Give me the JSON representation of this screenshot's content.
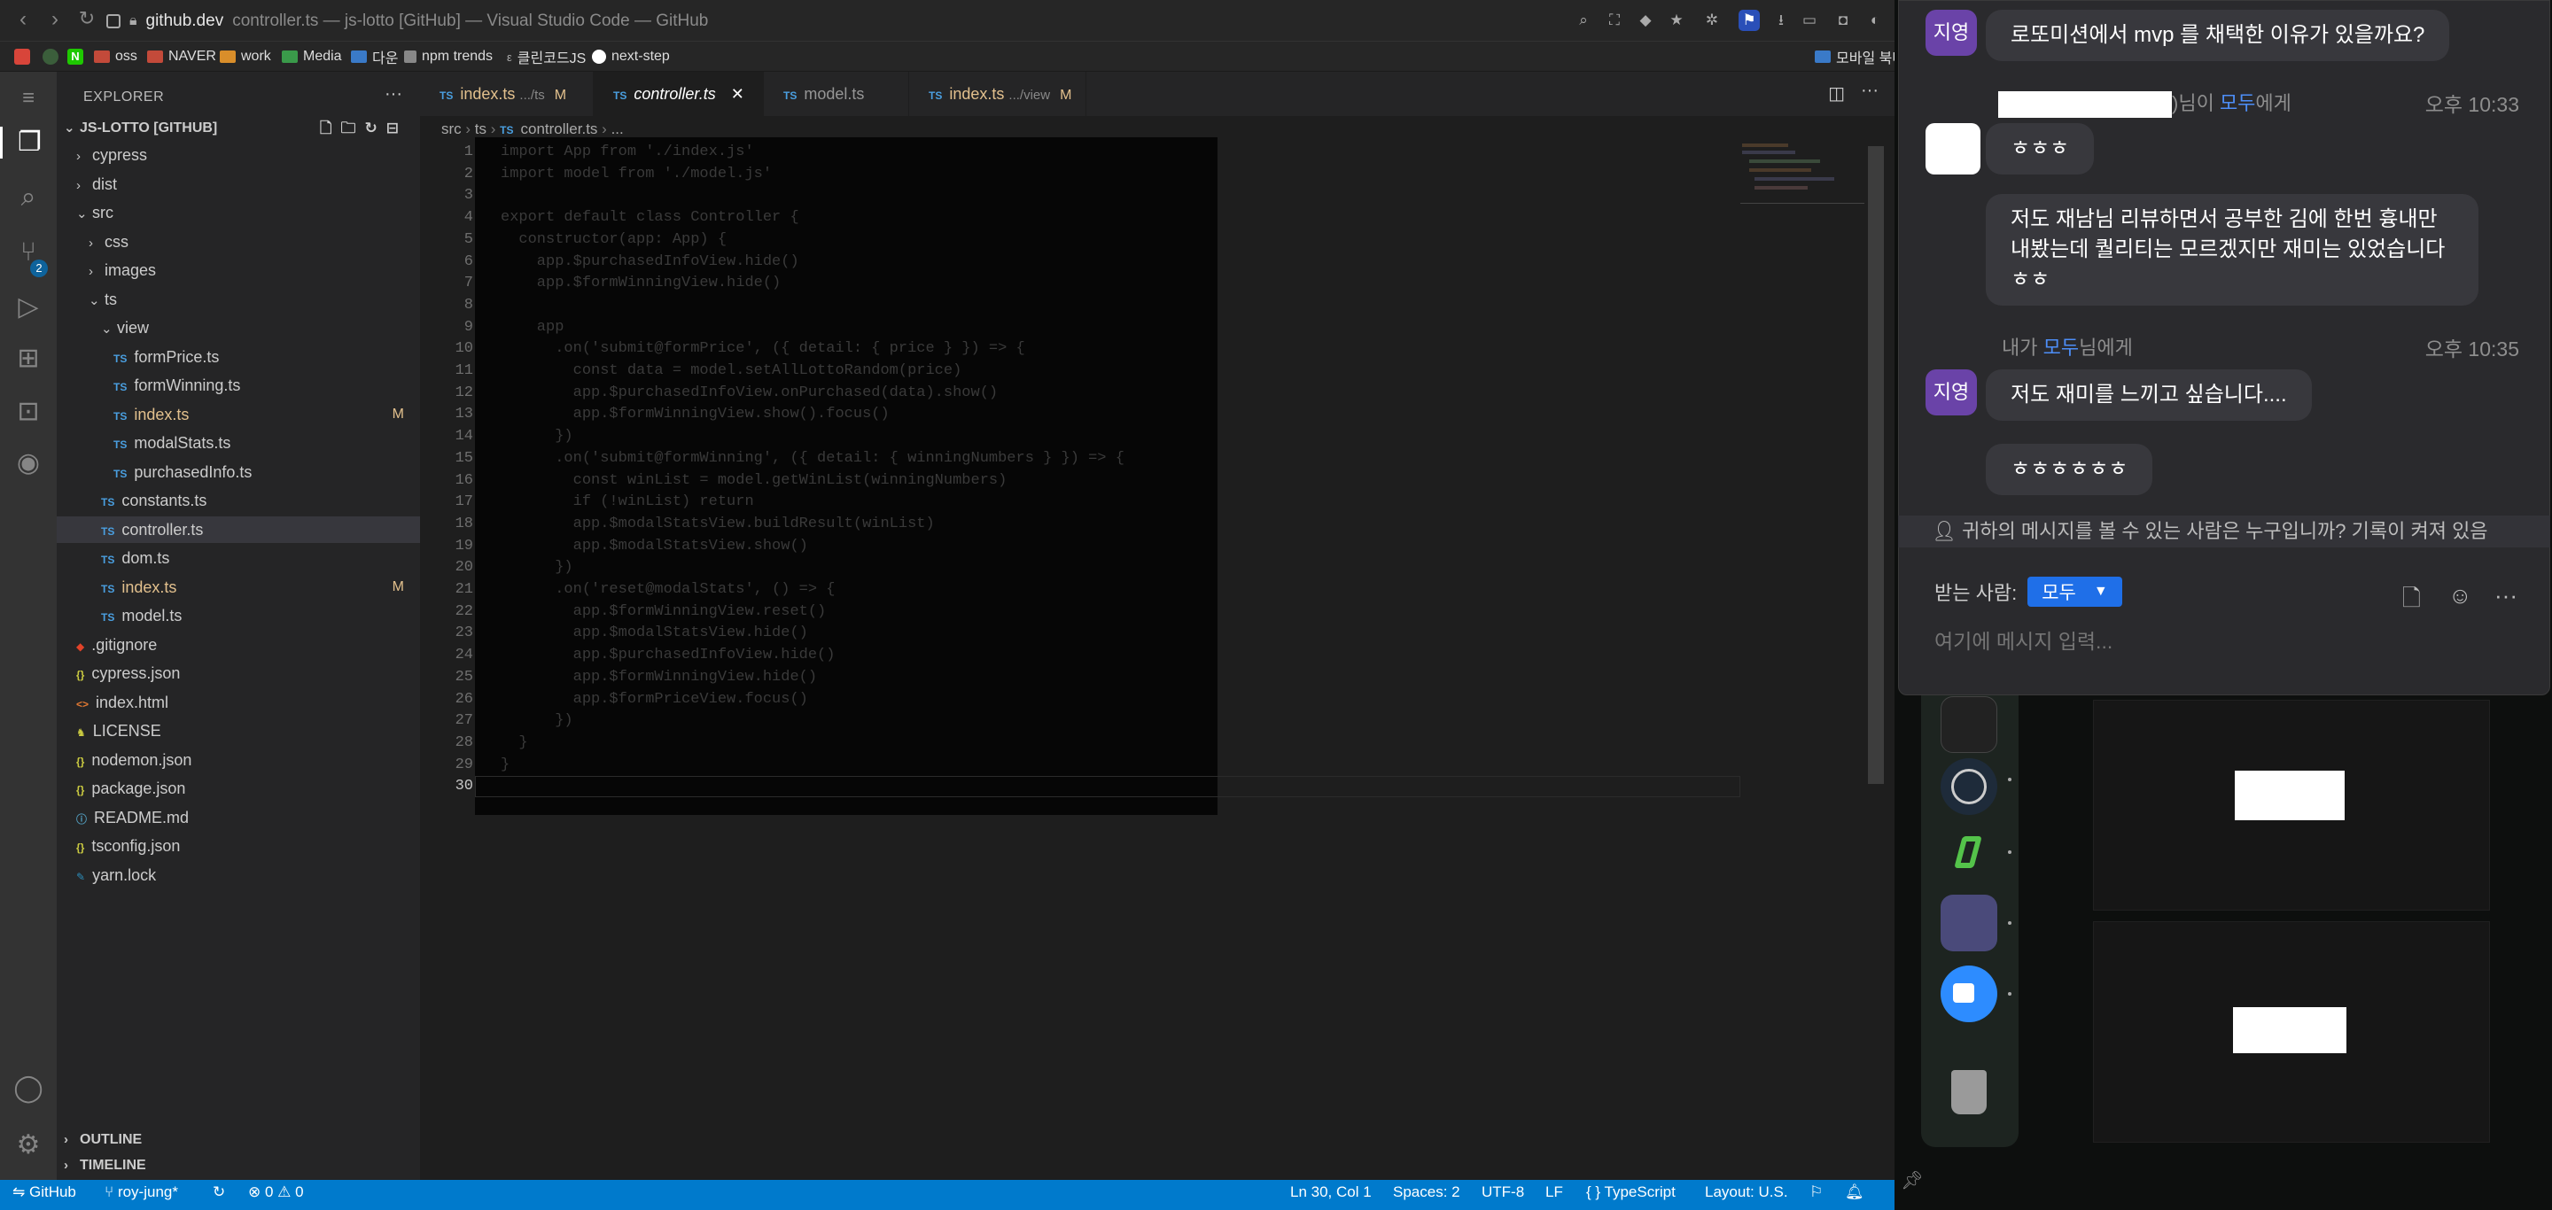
{
  "browser": {
    "domain": "github.dev",
    "page_title": "controller.ts — js-lotto [GitHub] — Visual Studio Code — GitHub",
    "bookmarks": [
      "oss",
      "NAVER",
      "work",
      "Media",
      "다운",
      "npm trends",
      "클린코드JS",
      "next-step"
    ],
    "bookmarks_right": "모바일 북마"
  },
  "explorer": {
    "title": "EXPLORER",
    "root": "JS-LOTTO [GITHUB]",
    "tree": [
      {
        "label": "cypress",
        "kind": "folder",
        "depth": 1,
        "open": false
      },
      {
        "label": "dist",
        "kind": "folder",
        "depth": 1,
        "open": false
      },
      {
        "label": "src",
        "kind": "folder",
        "depth": 1,
        "open": true
      },
      {
        "label": "css",
        "kind": "folder",
        "depth": 2,
        "open": false
      },
      {
        "label": "images",
        "kind": "folder",
        "depth": 2,
        "open": false
      },
      {
        "label": "ts",
        "kind": "folder",
        "depth": 2,
        "open": true
      },
      {
        "label": "view",
        "kind": "folder",
        "depth": 3,
        "open": true
      },
      {
        "label": "formPrice.ts",
        "kind": "ts",
        "depth": 4
      },
      {
        "label": "formWinning.ts",
        "kind": "ts",
        "depth": 4
      },
      {
        "label": "index.ts",
        "kind": "ts",
        "depth": 4,
        "modified": "M"
      },
      {
        "label": "modalStats.ts",
        "kind": "ts",
        "depth": 4
      },
      {
        "label": "purchasedInfo.ts",
        "kind": "ts",
        "depth": 4
      },
      {
        "label": "constants.ts",
        "kind": "ts",
        "depth": 3
      },
      {
        "label": "controller.ts",
        "kind": "ts",
        "depth": 3,
        "selected": true
      },
      {
        "label": "dom.ts",
        "kind": "ts",
        "depth": 3
      },
      {
        "label": "index.ts",
        "kind": "ts",
        "depth": 3,
        "modified": "M"
      },
      {
        "label": "model.ts",
        "kind": "ts",
        "depth": 3
      },
      {
        "label": ".gitignore",
        "kind": "git",
        "depth": 1
      },
      {
        "label": "cypress.json",
        "kind": "json",
        "depth": 1
      },
      {
        "label": "index.html",
        "kind": "html",
        "depth": 1
      },
      {
        "label": "LICENSE",
        "kind": "license",
        "depth": 1
      },
      {
        "label": "nodemon.json",
        "kind": "json",
        "depth": 1
      },
      {
        "label": "package.json",
        "kind": "json",
        "depth": 1
      },
      {
        "label": "README.md",
        "kind": "info",
        "depth": 1
      },
      {
        "label": "tsconfig.json",
        "kind": "json",
        "depth": 1
      },
      {
        "label": "yarn.lock",
        "kind": "yarn",
        "depth": 1
      }
    ],
    "outline": "OUTLINE",
    "timeline": "TIMELINE"
  },
  "tabs": [
    {
      "name": "index.ts",
      "path": ".../ts",
      "badge": "M",
      "active": false
    },
    {
      "name": "controller.ts",
      "path": "",
      "badge": "",
      "active": true
    },
    {
      "name": "model.ts",
      "path": "",
      "badge": "",
      "active": false
    },
    {
      "name": "index.ts",
      "path": ".../view",
      "badge": "M",
      "active": false
    }
  ],
  "breadcrumb": [
    "src",
    "ts",
    "controller.ts",
    "..."
  ],
  "code": [
    "import App from './index.js'",
    "import model from './model.js'",
    "",
    "export default class Controller {",
    "  constructor(app: App) {",
    "    app.$purchasedInfoView.hide()",
    "    app.$formWinningView.hide()",
    "",
    "    app",
    "      .on('submit@formPrice', ({ detail: { price } }) => {",
    "        const data = model.setAllLottoRandom(price)",
    "        app.$purchasedInfoView.onPurchased(data).show()",
    "        app.$formWinningView.show().focus()",
    "      })",
    "      .on('submit@formWinning', ({ detail: { winningNumbers } }) => {",
    "        const winList = model.getWinList(winningNumbers)",
    "        if (!winList) return",
    "        app.$modalStatsView.buildResult(winList)",
    "        app.$modalStatsView.show()",
    "      })",
    "      .on('reset@modalStats', () => {",
    "        app.$formWinningView.reset()",
    "        app.$modalStatsView.hide()",
    "        app.$purchasedInfoView.hide()",
    "        app.$formWinningView.hide()",
    "        app.$formPriceView.focus()",
    "      })",
    "  }",
    "}",
    ""
  ],
  "status": {
    "remote": "GitHub",
    "branch": "roy-jung*",
    "errors": "0",
    "warnings": "0",
    "position": "Ln 30, Col 1",
    "spaces": "Spaces: 2",
    "encoding": "UTF-8",
    "eol": "LF",
    "language": "TypeScript",
    "layout": "Layout: U.S."
  },
  "chat": {
    "top_avatar": "지영",
    "top_message": "로또미션에서 mvp 를 채택한 이유가 있을까요?",
    "meta1_suffix": ")님이",
    "meta1_to": "모두",
    "meta1_end": "에게",
    "time1": "오후 10:33",
    "msg1": "ㅎㅎㅎ",
    "msg2": "저도 재남님 리뷰하면서 공부한 김에 한번 흉내만 내봤는데 퀄리티는 모르겠지만 재미는 있었습니다 ㅎㅎ",
    "meta2_prefix": "내가",
    "meta2_to": "모두",
    "meta2_end": "님에게",
    "time2": "오후 10:35",
    "avatar2": "지영",
    "msg3": "저도 재미를 느끼고 싶습니다....",
    "msg4": "ㅎㅎㅎㅎㅎㅎ",
    "notice": "귀하의 메시지를 볼 수 있는 사람은 누구입니까? 기록이 켜져 있음",
    "recipient_label": "받는 사람:",
    "recipient_value": "모두",
    "input_placeholder": "여기에 메시지 입력..."
  },
  "colors": {
    "status_bar": "#007acc",
    "avatar": "#6a43a8",
    "chat_accent": "#1f6fe8",
    "modified": "#e2c08d"
  }
}
